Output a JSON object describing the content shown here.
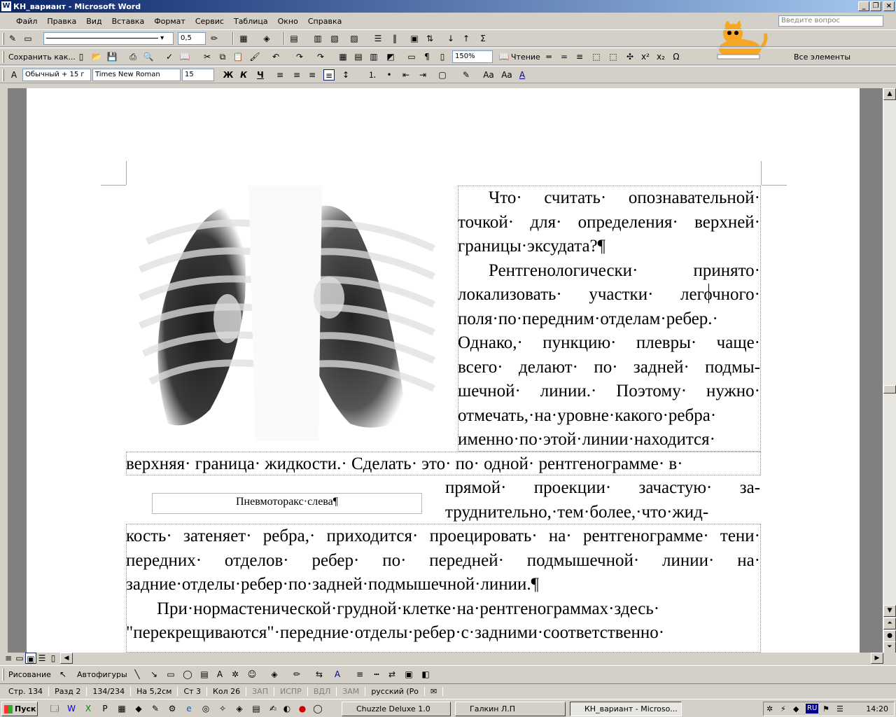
{
  "window": {
    "title": "КН_вариант - Microsoft Word"
  },
  "menu": {
    "items": [
      "Файл",
      "Правка",
      "Вид",
      "Вставка",
      "Формат",
      "Сервис",
      "Таблица",
      "Окно",
      "Справка"
    ],
    "ask_placeholder": "Введите вопрос"
  },
  "toolbar1": {
    "line_width": "0,5"
  },
  "toolbar2": {
    "save_as": "Сохранить как...",
    "zoom": "150%",
    "reading": "Чтение",
    "all_elements": "Все элементы"
  },
  "toolbar3": {
    "style": "Обычный + 15 г",
    "font": "Times New Roman",
    "size": "15",
    "bold": "Ж",
    "italic": "К",
    "underline": "Ч"
  },
  "document": {
    "p1": "Что· считать· опознавательной· точкой· для· определения· верхней· границы·эксудата?¶",
    "p2_side": "Рентгенологически· принято· локализовать· участки· легочного· поля·по·передним·отделам·ребер.· Однако,· пункцию· плевры· чаще· всего· делают· по· задней· подмы-шечной· линии.· Поэтому· нужно· отмечать,·на·уровне·какого·ребра· именно·по·этой·линии·находится·",
    "p2_full": "верхняя· граница· жидкости.· Сделать· это· по· одной· рентгенограмме· в·",
    "p2_right": "прямой· проекции· зачастую· за-труднительно,·тем·более,·что·жид-",
    "p2_end": "кость· затеняет· ребра,· приходится· проецировать· на· рентгенограмме· тени· передних· отделов· ребер· по· передней· подмышечной· линии· на· задние·отделы·ребер·по·задней·подмышечной·линии.¶",
    "p3": "При·нормастенической·грудной·клетке·на·рентгенограммах·здесь· \"перекрещиваются\"·передние·отделы·ребер·с·задними·соответственно·",
    "caption": "Пневмоторакс·слева¶"
  },
  "drawbar": {
    "drawing": "Рисование",
    "autoshapes": "Автофигуры"
  },
  "status": {
    "page": "Стр. 134",
    "section": "Разд 2",
    "pages": "134/234",
    "at": "На 5,2см",
    "line": "Ст 3",
    "col": "Кол 26",
    "rec": "ЗАП",
    "trk": "ИСПР",
    "ext": "ВДЛ",
    "ovr": "ЗАМ",
    "lang": "русский (Ро"
  },
  "taskbar": {
    "start": "Пуск",
    "tasks": [
      "Chuzzle Deluxe 1.0",
      "Галкин Л.П",
      "КН_вариант - Microsо..."
    ],
    "lang": "RU",
    "clock": "14:20"
  }
}
